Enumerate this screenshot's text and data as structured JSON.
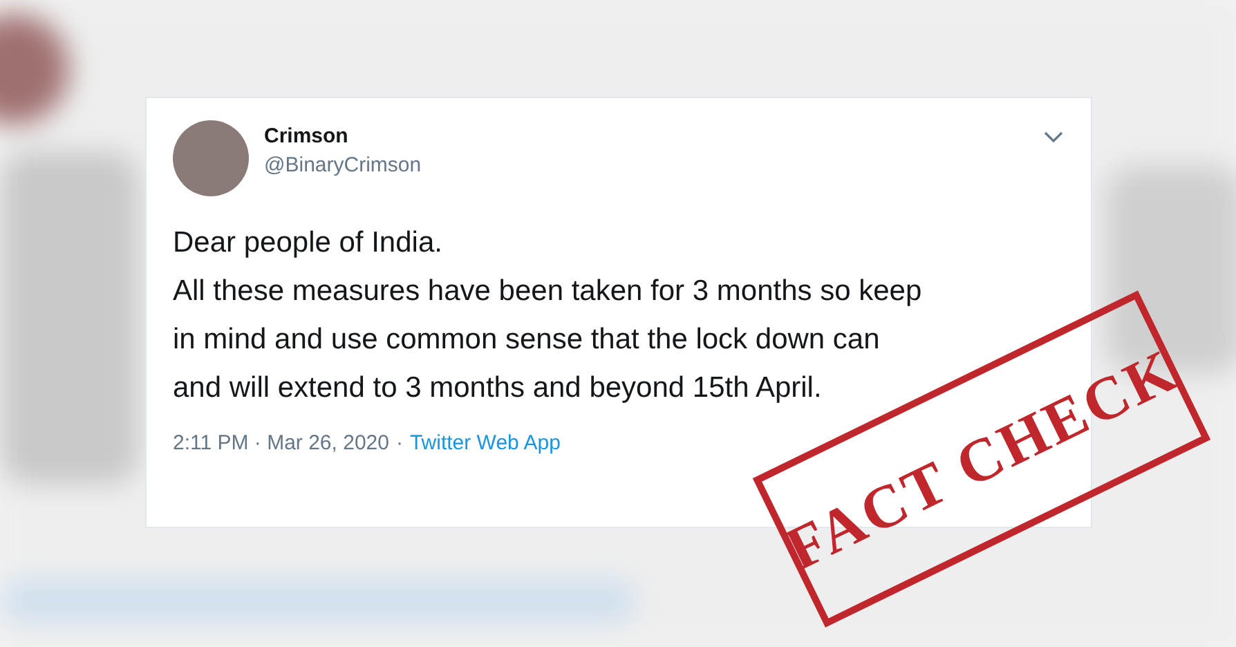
{
  "tweet": {
    "name": "Crimson",
    "handle": "@BinaryCrimson",
    "paragraphs": [
      "Dear people of India.",
      "All these measures have been taken for 3 months so keep in mind and use common sense that the lock down can and will extend to 3 months and beyond 15th April."
    ],
    "timestamp": "2:11 PM · Mar 26, 2020",
    "separator": "·",
    "source": "Twitter Web App"
  },
  "stamp": {
    "text": "FACT CHECK"
  }
}
